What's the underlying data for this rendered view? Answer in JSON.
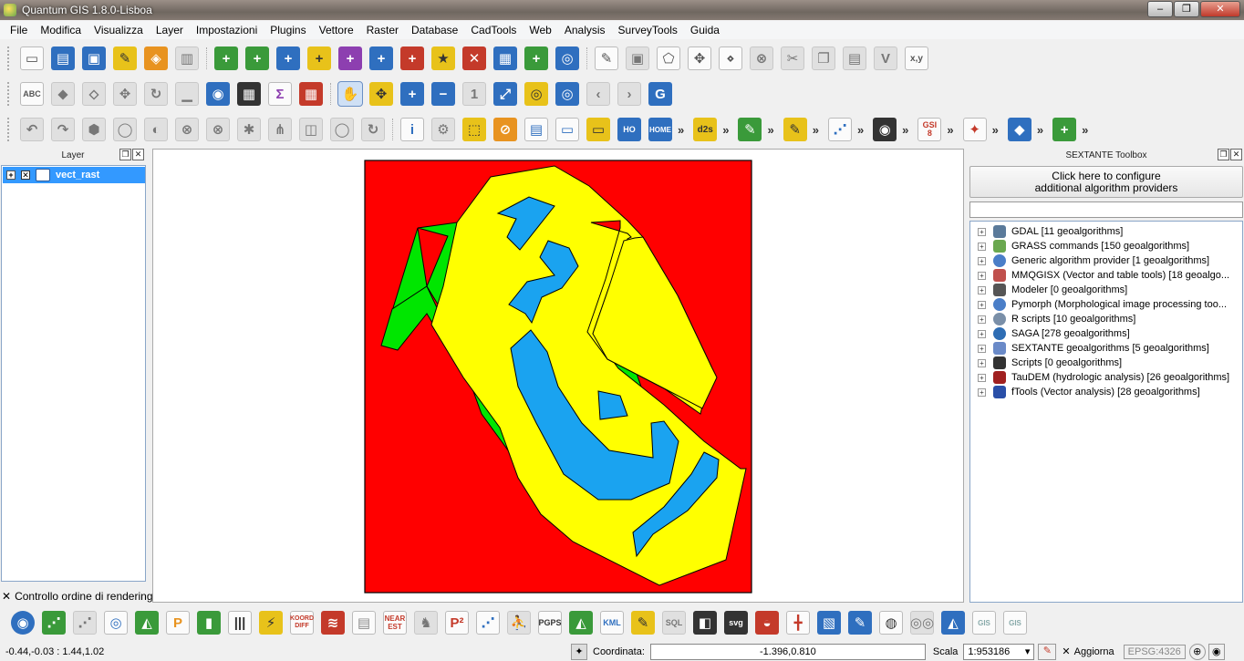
{
  "window": {
    "title": "Quantum GIS 1.8.0-Lisboa",
    "min": "–",
    "max": "❐",
    "close": "✕"
  },
  "menu": [
    "File",
    "Modifica",
    "Visualizza",
    "Layer",
    "Impostazioni",
    "Plugins",
    "Vettore",
    "Raster",
    "Database",
    "CadTools",
    "Web",
    "Analysis",
    "SurveyTools",
    "Guida"
  ],
  "layers_panel": {
    "title": "Layer",
    "layer_name": "vect_rast",
    "order_label": "Controllo ordine di rendering"
  },
  "toolbox": {
    "title": "SEXTANTE Toolbox",
    "config_line1": "Click here to configure",
    "config_line2": "additional algorithm providers",
    "search_value": "",
    "providers": [
      {
        "label": "GDAL [11 geoalgorithms]",
        "icon": "gdal-icon",
        "color": "#5a7a9a"
      },
      {
        "label": "GRASS commands [150 geoalgorithms]",
        "icon": "grass-icon",
        "color": "#6aa84f"
      },
      {
        "label": "Generic algorithm provider [1 geoalgorithms]",
        "icon": "gear-icon",
        "color": "#4a7ec8"
      },
      {
        "label": "MMQGISX (Vector and table tools) [18 geoalgo...",
        "icon": "mmqgis-icon",
        "color": "#c0504d"
      },
      {
        "label": "Modeler [0 geoalgorithms]",
        "icon": "modeler-icon",
        "color": "#555555"
      },
      {
        "label": "Pymorph (Morphological image processing too...",
        "icon": "pymorph-icon",
        "color": "#4a7ec8"
      },
      {
        "label": "R scripts [10 geoalgorithms]",
        "icon": "r-icon",
        "color": "#7a8fa8"
      },
      {
        "label": "SAGA [278 geoalgorithms]",
        "icon": "saga-icon",
        "color": "#2e6db4"
      },
      {
        "label": "SEXTANTE geoalgorithms [5 geoalgorithms]",
        "icon": "sextante-icon",
        "color": "#6a8ac8"
      },
      {
        "label": "Scripts [0 geoalgorithms]",
        "icon": "script-icon",
        "color": "#333333"
      },
      {
        "label": "TauDEM (hydrologic analysis) [26 geoalgorithms]",
        "icon": "taudem-icon",
        "color": "#a02020"
      },
      {
        "label": "fTools (Vector analysis) [28 geoalgorithms]",
        "icon": "ftools-icon",
        "color": "#2a4fa8"
      }
    ]
  },
  "toolbar_text": {
    "gsi": "GSI",
    "gsi_num": "8",
    "xy": "x,y",
    "d2s": "d2s",
    "ho": "HO",
    "home": "HOME",
    "koord": "KOORD DIFF",
    "near": "NEAR EST",
    "p2": "P²",
    "pgps": "PGPS",
    "svg": "svg",
    "more": "»"
  },
  "status": {
    "extent": "-0.44,-0.03 : 1.44,1.02",
    "coord_label": "Coordinata:",
    "coord_value": "-1.396,0.810",
    "scale_label": "Scala",
    "scale_value": "1:953186",
    "refresh_label": "Aggiorna",
    "crs": "EPSG:4326"
  },
  "colors": {
    "raster_red": "#ff0000",
    "poly_yellow": "#ffff00",
    "poly_green": "#00e600",
    "poly_blue": "#1aa3f0",
    "selection": "#3399ff"
  }
}
